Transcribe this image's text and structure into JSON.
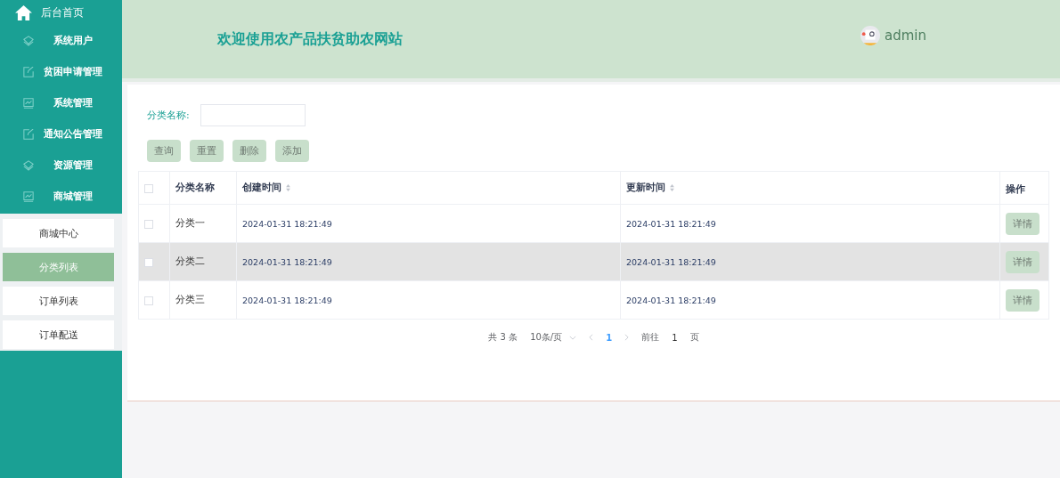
{
  "sidebar": {
    "home": "后台首页",
    "items": [
      {
        "label": "系统用户"
      },
      {
        "label": "贫困申请管理"
      },
      {
        "label": "系统管理"
      },
      {
        "label": "通知公告管理"
      },
      {
        "label": "资源管理"
      },
      {
        "label": "商城管理"
      }
    ],
    "submenu": [
      {
        "label": "商城中心",
        "selected": false
      },
      {
        "label": "分类列表",
        "selected": true
      },
      {
        "label": "订单列表",
        "selected": false
      },
      {
        "label": "订单配送",
        "selected": false
      }
    ]
  },
  "header": {
    "title": "欢迎使用农产品扶贫助农网站",
    "user": "admin"
  },
  "search": {
    "label": "分类名称:"
  },
  "buttons": [
    "查询",
    "重置",
    "删除",
    "添加"
  ],
  "table": {
    "all_checked": false,
    "columns": [
      {
        "label": "分类名称",
        "sortable": false
      },
      {
        "label": "创建时间",
        "sortable": true
      },
      {
        "label": "更新时间",
        "sortable": true
      },
      {
        "label": "操作",
        "sortable": false
      }
    ],
    "rows": [
      {
        "name": "分类一",
        "created": "2024-01-31 18:21:49",
        "updated": "2024-01-31 18:21:49",
        "action": "详情",
        "checked": false,
        "highlighted": false
      },
      {
        "name": "分类二",
        "created": "2024-01-31 18:21:49",
        "updated": "2024-01-31 18:21:49",
        "action": "详情",
        "checked": false,
        "highlighted": true
      },
      {
        "name": "分类三",
        "created": "2024-01-31 18:21:49",
        "updated": "2024-01-31 18:21:49",
        "action": "详情",
        "checked": false,
        "highlighted": false
      }
    ]
  },
  "pagination": {
    "total": "共 3 条",
    "page_size": "10条/页",
    "pages": [
      {
        "label": "1",
        "selected": true
      }
    ],
    "goto_label": "前往",
    "goto_value": "1",
    "goto_suffix": "页"
  }
}
